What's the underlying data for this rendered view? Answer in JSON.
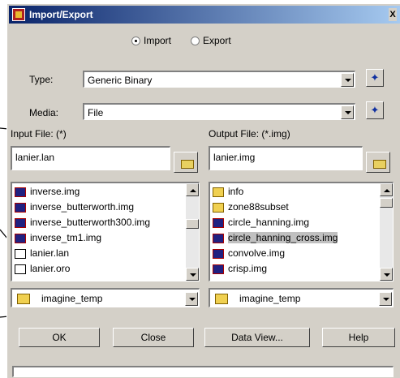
{
  "window": {
    "title": "Import/Export",
    "close_glyph": "X"
  },
  "mode": {
    "import_label": "Import",
    "export_label": "Export",
    "selected": "Import"
  },
  "type": {
    "label": "Type:",
    "value": "Generic Binary"
  },
  "media": {
    "label": "Media:",
    "value": "File"
  },
  "input": {
    "label": "Input File: (*)",
    "value": "lanier.lan",
    "files": [
      {
        "name": "inverse.img",
        "icon": "raster-image-icon"
      },
      {
        "name": "inverse_butterworth.img",
        "icon": "raster-image-icon"
      },
      {
        "name": "inverse_butterworth300.img",
        "icon": "raster-image-icon"
      },
      {
        "name": "inverse_tm1.img",
        "icon": "raster-image-icon"
      },
      {
        "name": "lanier.lan",
        "icon": "document-icon"
      },
      {
        "name": "lanier.oro",
        "icon": "document-icon"
      }
    ],
    "directory": "imagine_temp"
  },
  "output": {
    "label": "Output File: (*.img)",
    "value": "lanier.img",
    "files": [
      {
        "name": "info",
        "icon": "folder-icon"
      },
      {
        "name": "zone88subset",
        "icon": "folder-icon"
      },
      {
        "name": "circle_hanning.img",
        "icon": "raster-image-icon"
      },
      {
        "name": "circle_hanning_cross.img",
        "icon": "raster-image-icon",
        "selected": true
      },
      {
        "name": "convolve.img",
        "icon": "raster-image-icon"
      },
      {
        "name": "crisp.img",
        "icon": "raster-image-icon"
      }
    ],
    "directory": "imagine_temp"
  },
  "buttons": {
    "ok": "OK",
    "close": "Close",
    "data_view": "Data View...",
    "help": "Help"
  },
  "colors": {
    "title_start": "#0a246a",
    "title_end": "#a6caf0",
    "face": "#d4d0c8",
    "selection": "#c0c0c0"
  }
}
